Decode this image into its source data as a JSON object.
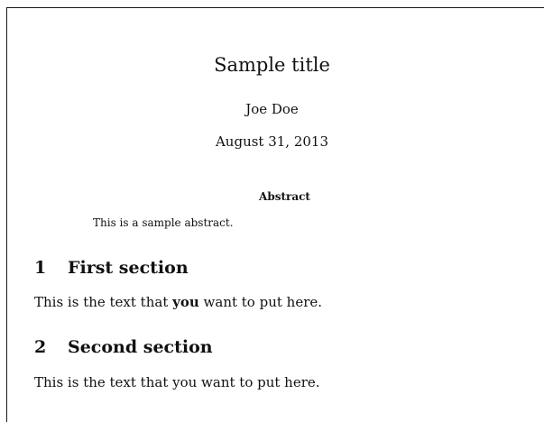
{
  "document": {
    "title": "Sample title",
    "author": "Joe Doe",
    "date": "August 31, 2013",
    "abstract": {
      "heading": "Abstract",
      "text": "This is a sample abstract."
    },
    "sections": [
      {
        "number": "1",
        "title": "First section",
        "text_before": "This is the text that ",
        "text_bold": "you",
        "text_after": " want to put here."
      },
      {
        "number": "2",
        "title": "Second section",
        "text": "This is the text that you want to put here."
      }
    ]
  }
}
